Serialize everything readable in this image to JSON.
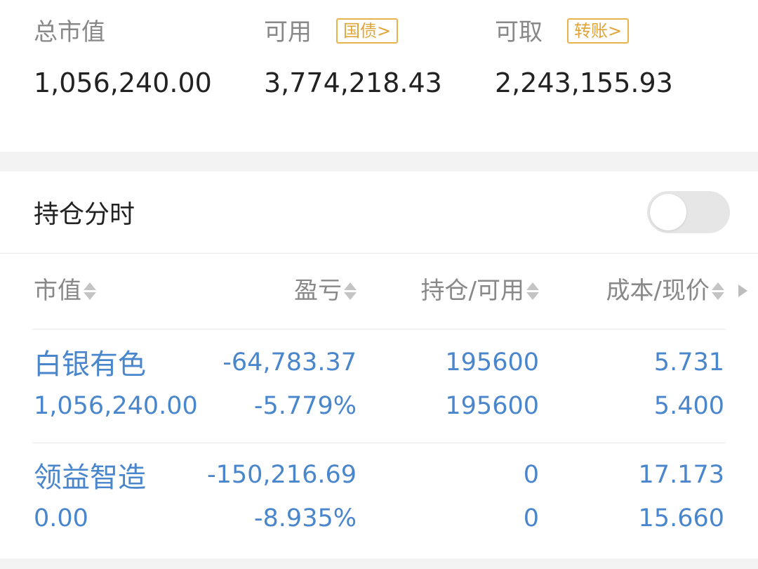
{
  "summary": {
    "total_market_value": {
      "label": "总市值",
      "value": "1,056,240.00"
    },
    "available": {
      "label": "可用",
      "tag": "国债",
      "value": "3,774,218.43"
    },
    "withdrawable": {
      "label": "可取",
      "tag": "转账",
      "value": "2,243,155.93"
    }
  },
  "positions_section": {
    "title": "持仓分时",
    "toggle_on": false
  },
  "table": {
    "headers": [
      "市值",
      "盈亏",
      "持仓/可用",
      "成本/现价"
    ],
    "rows": [
      {
        "name": "白银有色",
        "market_value": "1,056,240.00",
        "pnl": "-64,783.37",
        "pnl_pct": "-5.779%",
        "position": "195600",
        "available": "195600",
        "cost": "5.731",
        "price": "5.400"
      },
      {
        "name": "领益智造",
        "market_value": "0.00",
        "pnl": "-150,216.69",
        "pnl_pct": "-8.935%",
        "position": "0",
        "available": "0",
        "cost": "17.173",
        "price": "15.660"
      }
    ]
  },
  "colors": {
    "accent_blue": "#4a86cc",
    "tag_gold": "#e0a437",
    "label_gray": "#888888",
    "background_gray": "#f3f3f3"
  }
}
